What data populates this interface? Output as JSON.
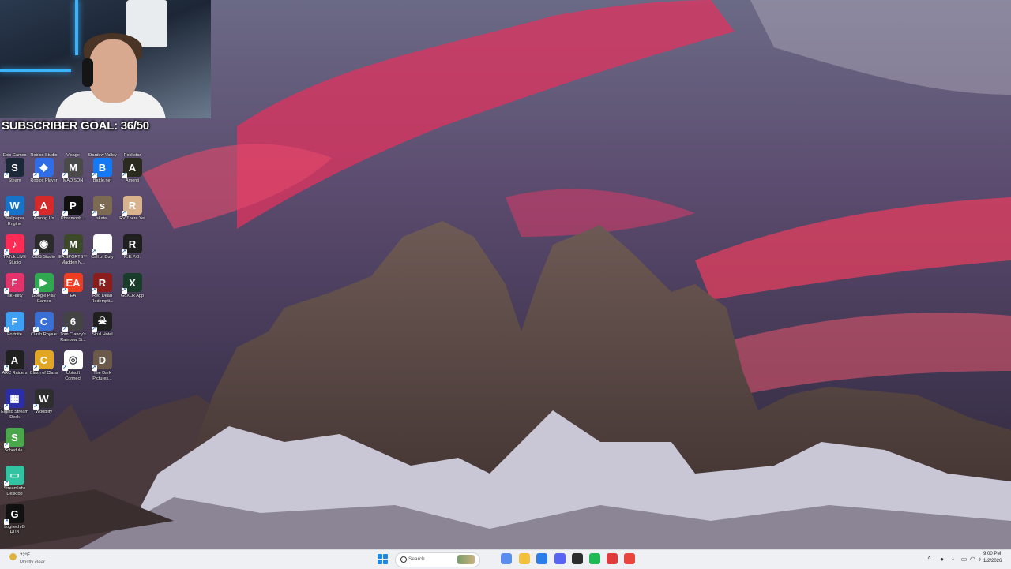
{
  "overlay": {
    "subscriber_goal": "SUBSCRIBER GOAL: 36/50"
  },
  "desktop": {
    "icons": [
      {
        "label": "Epic Games Launcher",
        "icon": "epic-games-icon",
        "color": "#2a2a2a",
        "glyph": "E"
      },
      {
        "label": "Roblox Studio",
        "icon": "roblox-studio-icon",
        "color": "#1d1d1d",
        "glyph": "R"
      },
      {
        "label": "Visage",
        "icon": "visage-icon",
        "color": "#3b3b3b",
        "glyph": "V"
      },
      {
        "label": "Stardew Valley",
        "icon": "stardew-valley-icon",
        "color": "#c58f3a",
        "glyph": "S"
      },
      {
        "label": "Rockstar Games ...",
        "icon": "rockstar-icon",
        "color": "#f5a623",
        "glyph": "R"
      },
      {
        "label": "Steam",
        "icon": "steam-icon",
        "color": "#1b2838",
        "glyph": "S"
      },
      {
        "label": "Roblox Player",
        "icon": "roblox-icon",
        "color": "#2f6ee6",
        "glyph": "◆"
      },
      {
        "label": "MADiSON",
        "icon": "madison-icon",
        "color": "#4a4a4a",
        "glyph": "M"
      },
      {
        "label": "Battle.net",
        "icon": "battlenet-icon",
        "color": "#1479f5",
        "glyph": "B"
      },
      {
        "label": "Amenti",
        "icon": "amenti-icon",
        "color": "#2a2a1e",
        "glyph": "A"
      },
      {
        "label": "Wallpaper Engine",
        "icon": "wallpaper-engine-icon",
        "color": "#1573c9",
        "glyph": "W"
      },
      {
        "label": "Among Us",
        "icon": "among-us-icon",
        "color": "#d42a2a",
        "glyph": "A"
      },
      {
        "label": "Phasmoph...",
        "icon": "phasmophobia-icon",
        "color": "#111111",
        "glyph": "P"
      },
      {
        "label": "skate.",
        "icon": "skate-icon",
        "color": "#7c6a52",
        "glyph": "s"
      },
      {
        "label": "RV There Yet",
        "icon": "rv-there-yet-icon",
        "color": "#d9b38c",
        "glyph": "R"
      },
      {
        "label": "TikTok LIVE Studio",
        "icon": "tiktok-icon",
        "color": "#fe2c55",
        "glyph": "♪"
      },
      {
        "label": "OBS Studio",
        "icon": "obs-icon",
        "color": "#2b2b2b",
        "glyph": "◉"
      },
      {
        "label": "EA SPORTS™ Madden N...",
        "icon": "madden-icon",
        "color": "#3c4a2a",
        "glyph": "M"
      },
      {
        "label": "Call of Duty",
        "icon": "file-icon",
        "color": "#ffffff",
        "glyph": ""
      },
      {
        "label": "R.E.P.O.",
        "icon": "repo-icon",
        "color": "#1f1f1f",
        "glyph": "R"
      },
      {
        "label": "TikFinity",
        "icon": "tikfinity-icon",
        "color": "#e2336b",
        "glyph": "F"
      },
      {
        "label": "Google Play Games",
        "icon": "google-play-games-icon",
        "color": "#2fa84f",
        "glyph": "▶"
      },
      {
        "label": "EA",
        "icon": "ea-icon",
        "color": "#ef3d22",
        "glyph": "EA"
      },
      {
        "label": "Red Dead Redempti...",
        "icon": "red-dead-icon",
        "color": "#8b1d1d",
        "glyph": "R"
      },
      {
        "label": "GoXLR App",
        "icon": "goxlr-icon",
        "color": "#1a3d2b",
        "glyph": "X"
      },
      {
        "label": "Fortnite",
        "icon": "fortnite-icon",
        "color": "#3ea0f5",
        "glyph": "F"
      },
      {
        "label": "Clash Royale",
        "icon": "clash-royale-icon",
        "color": "#3a6fd4",
        "glyph": "C"
      },
      {
        "label": "Tom Clancy's Rainbow Si...",
        "icon": "rainbow-six-icon",
        "color": "#444444",
        "glyph": "6"
      },
      {
        "label": "Skull Hotel",
        "icon": "skull-hotel-icon",
        "color": "#202020",
        "glyph": "☠"
      },
      {
        "label": "ARC Raiders",
        "icon": "arc-raiders-icon",
        "color": "#202020",
        "glyph": "A"
      },
      {
        "label": "Clash of Clans",
        "icon": "clash-of-clans-icon",
        "color": "#e2a627",
        "glyph": "C"
      },
      {
        "label": "Ubisoft Connect",
        "icon": "ubisoft-icon",
        "color": "#ffffff",
        "glyph": "◎"
      },
      {
        "label": "The Dark Pictures...",
        "icon": "dark-pictures-icon",
        "color": "#6b5a4a",
        "glyph": "D"
      },
      {
        "label": "Elgato Stream Deck",
        "icon": "stream-deck-icon",
        "color": "#2a2fa8",
        "glyph": "▦"
      },
      {
        "label": "Wooblity",
        "icon": "wooblity-icon",
        "color": "#2e2e2e",
        "glyph": "W"
      },
      {
        "label": "Schedule I",
        "icon": "schedule-i-icon",
        "color": "#4aa84a",
        "glyph": "S"
      },
      {
        "label": "Streamlabs Desktop",
        "icon": "streamlabs-icon",
        "color": "#31c3a2",
        "glyph": "▭"
      },
      {
        "label": "Logitech G HUB",
        "icon": "logitech-ghub-icon",
        "color": "#111111",
        "glyph": "G"
      }
    ]
  },
  "taskbar": {
    "weather": {
      "temp": "22°F",
      "desc": "Mostly clear"
    },
    "search_placeholder": "Search",
    "apps": [
      {
        "name": "copilot-app",
        "color": "#5b8def"
      },
      {
        "name": "file-explorer-app",
        "color": "#f2c03a"
      },
      {
        "name": "store-app",
        "color": "#2b7de9"
      },
      {
        "name": "discord-app",
        "color": "#5865f2"
      },
      {
        "name": "terminal-app",
        "color": "#2d2d2d"
      },
      {
        "name": "spotify-app",
        "color": "#1db954"
      },
      {
        "name": "roblox-app",
        "color": "#e03b3b"
      },
      {
        "name": "chrome-app",
        "color": "#e8453c"
      }
    ],
    "clock": {
      "time": "9:00 PM",
      "date": "1/2/2026"
    }
  }
}
